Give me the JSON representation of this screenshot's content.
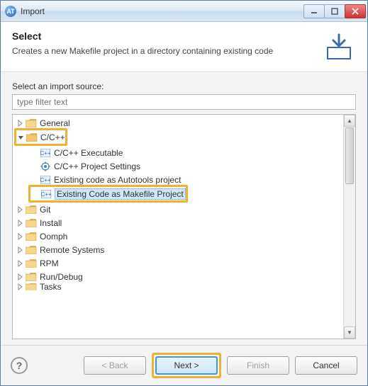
{
  "window": {
    "title": "Import"
  },
  "header": {
    "title": "Select",
    "description": "Creates a new Makefile project in a directory containing existing code"
  },
  "body": {
    "source_label": "Select an import source:",
    "filter_placeholder": "type filter text"
  },
  "tree": {
    "items": [
      {
        "label": "General",
        "expanded": false,
        "depth": 0,
        "type": "folder"
      },
      {
        "label": "C/C++",
        "expanded": true,
        "depth": 0,
        "type": "folder",
        "highlighted": true
      },
      {
        "label": "C/C++ Executable",
        "depth": 1,
        "type": "leaf",
        "icon": "c-exec"
      },
      {
        "label": "C/C++ Project Settings",
        "depth": 1,
        "type": "leaf",
        "icon": "settings"
      },
      {
        "label": "Existing code as Autotools project",
        "depth": 1,
        "type": "leaf",
        "icon": "c-proj"
      },
      {
        "label": "Existing Code as Makefile Project",
        "depth": 1,
        "type": "leaf",
        "icon": "c-proj",
        "selected": true,
        "highlighted": true
      },
      {
        "label": "Git",
        "expanded": false,
        "depth": 0,
        "type": "folder"
      },
      {
        "label": "Install",
        "expanded": false,
        "depth": 0,
        "type": "folder"
      },
      {
        "label": "Oomph",
        "expanded": false,
        "depth": 0,
        "type": "folder"
      },
      {
        "label": "Remote Systems",
        "expanded": false,
        "depth": 0,
        "type": "folder"
      },
      {
        "label": "RPM",
        "expanded": false,
        "depth": 0,
        "type": "folder"
      },
      {
        "label": "Run/Debug",
        "expanded": false,
        "depth": 0,
        "type": "folder"
      },
      {
        "label": "Tasks",
        "expanded": false,
        "depth": 0,
        "type": "folder",
        "cutoff": true
      }
    ]
  },
  "buttons": {
    "back": "< Back",
    "next": "Next >",
    "finish": "Finish",
    "cancel": "Cancel"
  }
}
